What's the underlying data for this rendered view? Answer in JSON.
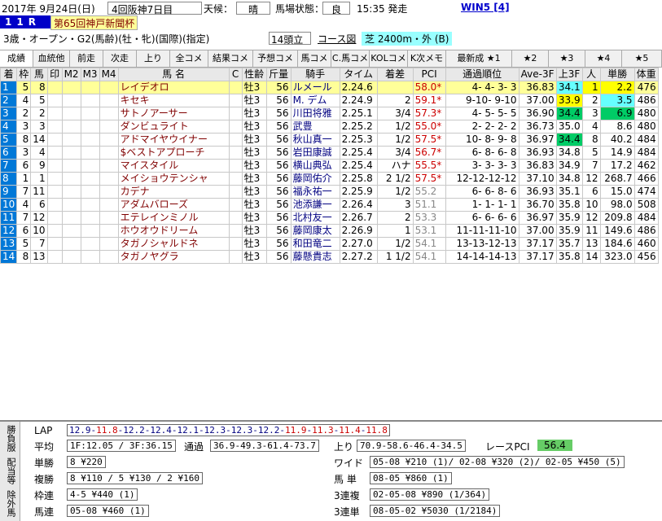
{
  "header": {
    "date": "2017年 9月24日(日)",
    "meeting": "4回阪神7日目",
    "weather_label": "天候：",
    "weather": "晴",
    "track_label": "馬場状態：",
    "track": "良",
    "post_time": "15:35 発走",
    "win5": "WIN5 [4]"
  },
  "race": {
    "number": "11R",
    "name": "第65回神戸新聞杯",
    "conditions": "3歳・オープン・G2(馬齢)(牡・牝)(国際)(指定)",
    "runners": "14頭立",
    "course_label": "コース図",
    "course": "芝 2400m・外 (B)"
  },
  "tabs": [
    "成績",
    "血統他",
    "前走",
    "次走",
    "上り",
    "全コメ",
    "結果コメ",
    "予想コメ",
    "馬コメ",
    "C.馬コメ",
    "KOLコメ",
    "K次メモ",
    "最新成 ★1",
    "★2",
    "★3",
    "★4",
    "★5"
  ],
  "columns": [
    "着",
    "枠",
    "馬",
    "印",
    "M2",
    "M3",
    "M4",
    "馬 名",
    "C",
    "性齢",
    "斤量",
    "騎手",
    "タイム",
    "着差",
    "PCI",
    "通過順位",
    "Ave-3F",
    "上3F",
    "人",
    "単勝",
    "体重"
  ],
  "rows": [
    {
      "rank": "1",
      "waku": "5",
      "uma": "8",
      "name": "レイデオロ",
      "sex": "牡3",
      "kg": "56",
      "jockey": "ルメール",
      "time": "2.24.6",
      "diff": "",
      "pci": "58.0*",
      "pci_gray": false,
      "pass": "4- 4- 3- 3",
      "ave": "36.83",
      "agari": "34.1",
      "agari_hl": "c",
      "pop": "1",
      "pop_hl": "y",
      "odds": "2.2",
      "odds_hl": "y",
      "weight": "476"
    },
    {
      "rank": "2",
      "waku": "4",
      "uma": "5",
      "name": "キセキ",
      "sex": "牡3",
      "kg": "56",
      "jockey": "M. デム",
      "time": "2.24.9",
      "diff": "2",
      "pci": "59.1*",
      "pci_gray": false,
      "pass": "9-10- 9-10",
      "ave": "37.00",
      "agari": "33.9",
      "agari_hl": "y",
      "pop": "2",
      "pop_hl": "",
      "odds": "3.5",
      "odds_hl": "c",
      "weight": "486"
    },
    {
      "rank": "3",
      "waku": "2",
      "uma": "2",
      "name": "サトノアーサー",
      "sex": "牡3",
      "kg": "56",
      "jockey": "川田将雅",
      "time": "2.25.1",
      "diff": "3/4",
      "pci": "57.3*",
      "pci_gray": false,
      "pass": "4- 5- 5- 5",
      "ave": "36.90",
      "agari": "34.4",
      "agari_hl": "g",
      "pop": "3",
      "pop_hl": "",
      "odds": "6.9",
      "odds_hl": "g",
      "weight": "480"
    },
    {
      "rank": "4",
      "waku": "3",
      "uma": "3",
      "name": "ダンビュライト",
      "sex": "牡3",
      "kg": "56",
      "jockey": "武豊",
      "time": "2.25.2",
      "diff": "1/2",
      "pci": "55.0*",
      "pci_gray": false,
      "pass": "2- 2- 2- 2",
      "ave": "36.73",
      "agari": "35.0",
      "agari_hl": "",
      "pop": "4",
      "pop_hl": "",
      "odds": "8.6",
      "odds_hl": "",
      "weight": "480"
    },
    {
      "rank": "5",
      "waku": "8",
      "uma": "14",
      "name": "アドマイヤウイナー",
      "sex": "牡3",
      "kg": "56",
      "jockey": "秋山真一",
      "time": "2.25.3",
      "diff": "1/2",
      "pci": "57.5*",
      "pci_gray": false,
      "pass": "10- 8- 9- 8",
      "ave": "36.97",
      "agari": "34.4",
      "agari_hl": "g",
      "pop": "8",
      "pop_hl": "",
      "odds": "40.2",
      "odds_hl": "",
      "weight": "484"
    },
    {
      "rank": "6",
      "waku": "3",
      "uma": "4",
      "name": "$ベストアプローチ",
      "sex": "牡3",
      "kg": "56",
      "jockey": "岩田康誠",
      "time": "2.25.4",
      "diff": "3/4",
      "pci": "56.7*",
      "pci_gray": false,
      "pass": "6- 8- 6- 8",
      "ave": "36.93",
      "agari": "34.8",
      "agari_hl": "",
      "pop": "5",
      "pop_hl": "",
      "odds": "14.9",
      "odds_hl": "",
      "weight": "484"
    },
    {
      "rank": "7",
      "waku": "6",
      "uma": "9",
      "name": "マイスタイル",
      "sex": "牡3",
      "kg": "56",
      "jockey": "横山典弘",
      "time": "2.25.4",
      "diff": "ハナ",
      "pci": "55.5*",
      "pci_gray": false,
      "pass": "3- 3- 3- 3",
      "ave": "36.83",
      "agari": "34.9",
      "agari_hl": "",
      "pop": "7",
      "pop_hl": "",
      "odds": "17.2",
      "odds_hl": "",
      "weight": "462"
    },
    {
      "rank": "8",
      "waku": "1",
      "uma": "1",
      "name": "メイショウテンシャ",
      "sex": "牡3",
      "kg": "56",
      "jockey": "藤岡佑介",
      "time": "2.25.8",
      "diff": "2 1/2",
      "pci": "57.5*",
      "pci_gray": false,
      "pass": "12-12-12-12",
      "ave": "37.10",
      "agari": "34.8",
      "agari_hl": "",
      "pop": "12",
      "pop_hl": "",
      "odds": "268.7",
      "odds_hl": "",
      "weight": "466"
    },
    {
      "rank": "9",
      "waku": "7",
      "uma": "11",
      "name": "カデナ",
      "sex": "牡3",
      "kg": "56",
      "jockey": "福永祐一",
      "time": "2.25.9",
      "diff": "1/2",
      "pci": "55.2",
      "pci_gray": true,
      "pass": "6- 6- 8- 6",
      "ave": "36.93",
      "agari": "35.1",
      "agari_hl": "",
      "pop": "6",
      "pop_hl": "",
      "odds": "15.0",
      "odds_hl": "",
      "weight": "474"
    },
    {
      "rank": "10",
      "waku": "4",
      "uma": "6",
      "name": "アダムバローズ",
      "sex": "牡3",
      "kg": "56",
      "jockey": "池添謙一",
      "time": "2.26.4",
      "diff": "3",
      "pci": "51.1",
      "pci_gray": true,
      "pass": "1- 1- 1- 1",
      "ave": "36.70",
      "agari": "35.8",
      "agari_hl": "",
      "pop": "10",
      "pop_hl": "",
      "odds": "98.0",
      "odds_hl": "",
      "weight": "508"
    },
    {
      "rank": "11",
      "waku": "7",
      "uma": "12",
      "name": "エテレインミノル",
      "sex": "牡3",
      "kg": "56",
      "jockey": "北村友一",
      "time": "2.26.7",
      "diff": "2",
      "pci": "53.3",
      "pci_gray": true,
      "pass": "6- 6- 6- 6",
      "ave": "36.97",
      "agari": "35.9",
      "agari_hl": "",
      "pop": "12",
      "pop_hl": "",
      "odds": "209.8",
      "odds_hl": "",
      "weight": "484"
    },
    {
      "rank": "12",
      "waku": "6",
      "uma": "10",
      "name": "ホウオウドリーム",
      "sex": "牡3",
      "kg": "56",
      "jockey": "藤岡康太",
      "time": "2.26.9",
      "diff": "1",
      "pci": "53.1",
      "pci_gray": true,
      "pass": "11-11-11-10",
      "ave": "37.00",
      "agari": "35.9",
      "agari_hl": "",
      "pop": "11",
      "pop_hl": "",
      "odds": "149.6",
      "odds_hl": "",
      "weight": "486"
    },
    {
      "rank": "13",
      "waku": "5",
      "uma": "7",
      "name": "タガノシャルドネ",
      "sex": "牡3",
      "kg": "56",
      "jockey": "和田竜二",
      "time": "2.27.0",
      "diff": "1/2",
      "pci": "54.1",
      "pci_gray": true,
      "pass": "13-13-12-13",
      "ave": "37.17",
      "agari": "35.7",
      "agari_hl": "",
      "pop": "13",
      "pop_hl": "",
      "odds": "184.6",
      "odds_hl": "",
      "weight": "460"
    },
    {
      "rank": "14",
      "waku": "8",
      "uma": "13",
      "name": "タガノヤグラ",
      "sex": "牡3",
      "kg": "56",
      "jockey": "藤懸貴志",
      "time": "2.27.2",
      "diff": "1 1/2",
      "pci": "54.1",
      "pci_gray": true,
      "pass": "14-14-14-13",
      "ave": "37.17",
      "agari": "35.8",
      "agari_hl": "",
      "pop": "14",
      "pop_hl": "",
      "odds": "323.0",
      "odds_hl": "",
      "weight": "456"
    }
  ],
  "bottom": {
    "side_tabs": [
      "勝負服",
      "配当等",
      "除外馬"
    ],
    "lap_label": "LAP",
    "laps": [
      {
        "v": "12.9",
        "red": false
      },
      {
        "v": "11.8",
        "red": true
      },
      {
        "v": "12.2",
        "red": false
      },
      {
        "v": "12.4",
        "red": false
      },
      {
        "v": "12.1",
        "red": false
      },
      {
        "v": "12.3",
        "red": false
      },
      {
        "v": "12.3",
        "red": false
      },
      {
        "v": "12.2",
        "red": false
      },
      {
        "v": "11.9",
        "red": true
      },
      {
        "v": "11.3",
        "red": true
      },
      {
        "v": "11.4",
        "red": true
      },
      {
        "v": "11.8",
        "red": true
      }
    ],
    "avg_label": "平均",
    "avg": "1F:12.05 / 3F:36.15",
    "pass_label": "通過",
    "pass": "36.9-49.3-61.4-73.7",
    "agari_label": "上り",
    "agari": "70.9-58.6-46.4-34.5",
    "race_pci_label": "レースPCI",
    "race_pci": "56.4",
    "payouts_left": [
      {
        "label": "単勝",
        "value": "8  ¥220"
      },
      {
        "label": "複勝",
        "value": "8  ¥110 / 5  ¥130 / 2  ¥160"
      },
      {
        "label": "枠連",
        "value": "4-5  ¥440 (1)"
      },
      {
        "label": "馬連",
        "value": "05-08  ¥460 (1)"
      }
    ],
    "payouts_right": [
      {
        "label": "ワイド",
        "value": "05-08 ¥210 (1)/ 02-08 ¥320 (2)/ 02-05 ¥450 (5)"
      },
      {
        "label": "馬 単",
        "value": "08-05  ¥860 (1)"
      },
      {
        "label": "3連複",
        "value": "02-05-08  ¥890 (1/364)"
      },
      {
        "label": "3連単",
        "value": "08-05-02  ¥5030 (1/2184)"
      }
    ]
  }
}
